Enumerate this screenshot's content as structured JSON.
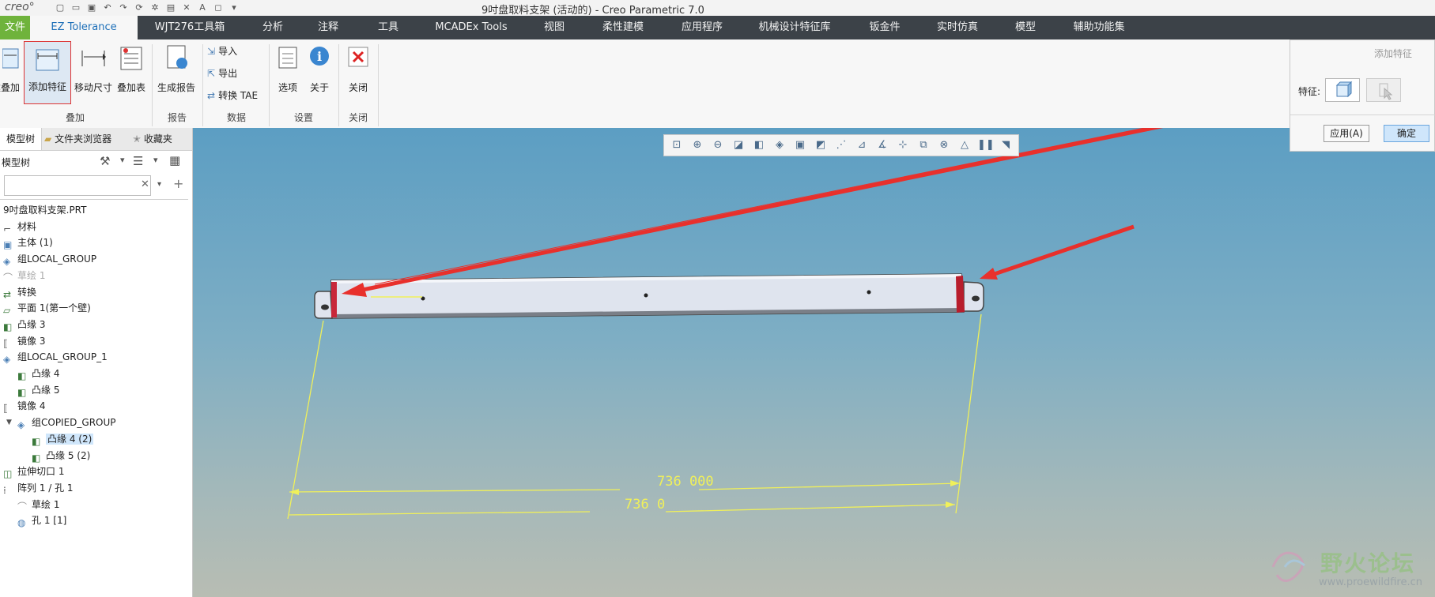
{
  "app": {
    "logo": "creo°",
    "window_title": "9吋盘取料支架 (活动的) - Creo Parametric 7.0"
  },
  "tabs": [
    {
      "label": "文件"
    },
    {
      "label": "EZ Tolerance"
    },
    {
      "label": "WJT276工具箱"
    },
    {
      "label": "分析"
    },
    {
      "label": "注释"
    },
    {
      "label": "工具"
    },
    {
      "label": "MCADEx Tools"
    },
    {
      "label": "视图"
    },
    {
      "label": "柔性建模"
    },
    {
      "label": "应用程序"
    },
    {
      "label": "机械设计特征库"
    },
    {
      "label": "钣金件"
    },
    {
      "label": "实时仿真"
    },
    {
      "label": "模型"
    },
    {
      "label": "辅助功能集"
    }
  ],
  "ribbon": {
    "stack_label": "建叠加",
    "add_feature_label": "添加特征",
    "move_dim_label": "移动尺寸",
    "stack_table_label": "叠加表",
    "group_stack": "叠加",
    "gen_report_label": "生成报告",
    "group_report": "报告",
    "import_label": "导入",
    "export_label": "导出",
    "convert_tae_label": "转换 TAE",
    "group_data": "数据",
    "options_label": "选项",
    "about_label": "关于",
    "group_settings": "设置",
    "close_label": "关闭",
    "group_close": "关闭"
  },
  "sidepanel": {
    "tabs": [
      "模型树",
      "文件夹浏览器",
      "收藏夹"
    ],
    "tree_title": "模型树",
    "search_value": "",
    "items": [
      {
        "label": "9吋盘取料支架.PRT",
        "icon": "part-icon",
        "indent": 0
      },
      {
        "label": "材料",
        "icon": "material-icon",
        "indent": 0
      },
      {
        "label": "主体 (1)",
        "icon": "body-icon",
        "indent": 0
      },
      {
        "label": "组LOCAL_GROUP",
        "icon": "group-icon",
        "indent": 0
      },
      {
        "label": "草绘 1",
        "icon": "sketch-icon",
        "indent": 0
      },
      {
        "label": "转换",
        "icon": "convert-icon",
        "indent": 0
      },
      {
        "label": "平面 1(第一个壁)",
        "icon": "flat-wall-icon",
        "indent": 0
      },
      {
        "label": "凸缘 3",
        "icon": "flange-icon",
        "indent": 0
      },
      {
        "label": "镜像 3",
        "icon": "mirror-icon",
        "indent": 0
      },
      {
        "label": "组LOCAL_GROUP_1",
        "icon": "group-icon",
        "indent": 0
      },
      {
        "label": "凸缘 4",
        "icon": "flange-icon",
        "indent": 1
      },
      {
        "label": "凸缘 5",
        "icon": "flange-icon",
        "indent": 1
      },
      {
        "label": "镜像 4",
        "icon": "mirror-icon",
        "indent": 0
      },
      {
        "label": "组COPIED_GROUP",
        "icon": "group-icon",
        "indent": 0
      },
      {
        "label": "凸缘 4 (2)",
        "icon": "flange-icon",
        "indent": 2
      },
      {
        "label": "凸缘 5 (2)",
        "icon": "flange-icon",
        "indent": 2
      },
      {
        "label": "拉伸切口 1",
        "icon": "extrude-cut-icon",
        "indent": 0
      },
      {
        "label": "阵列 1 / 孔 1",
        "icon": "pattern-icon",
        "indent": 0
      },
      {
        "label": "草绘 1",
        "icon": "sketch-icon",
        "indent": 1
      },
      {
        "label": "孔 1 [1]",
        "icon": "hole-icon",
        "indent": 1
      }
    ]
  },
  "dialog": {
    "title": "添加特征",
    "feature_label": "特征:",
    "apply_label": "应用(A)",
    "ok_label": "确定"
  },
  "viewport": {
    "dim_upper": "736 000",
    "dim_lower": "736 0"
  },
  "watermark": {
    "text": "野火论坛",
    "url": "www.proewildfire.cn"
  },
  "colors": {
    "tab_bar": "#3c4248",
    "file_tab": "#6fb33c",
    "highlight": "#cfe6fb",
    "dimension": "#f0f05a",
    "arrow": "#e8302c"
  }
}
